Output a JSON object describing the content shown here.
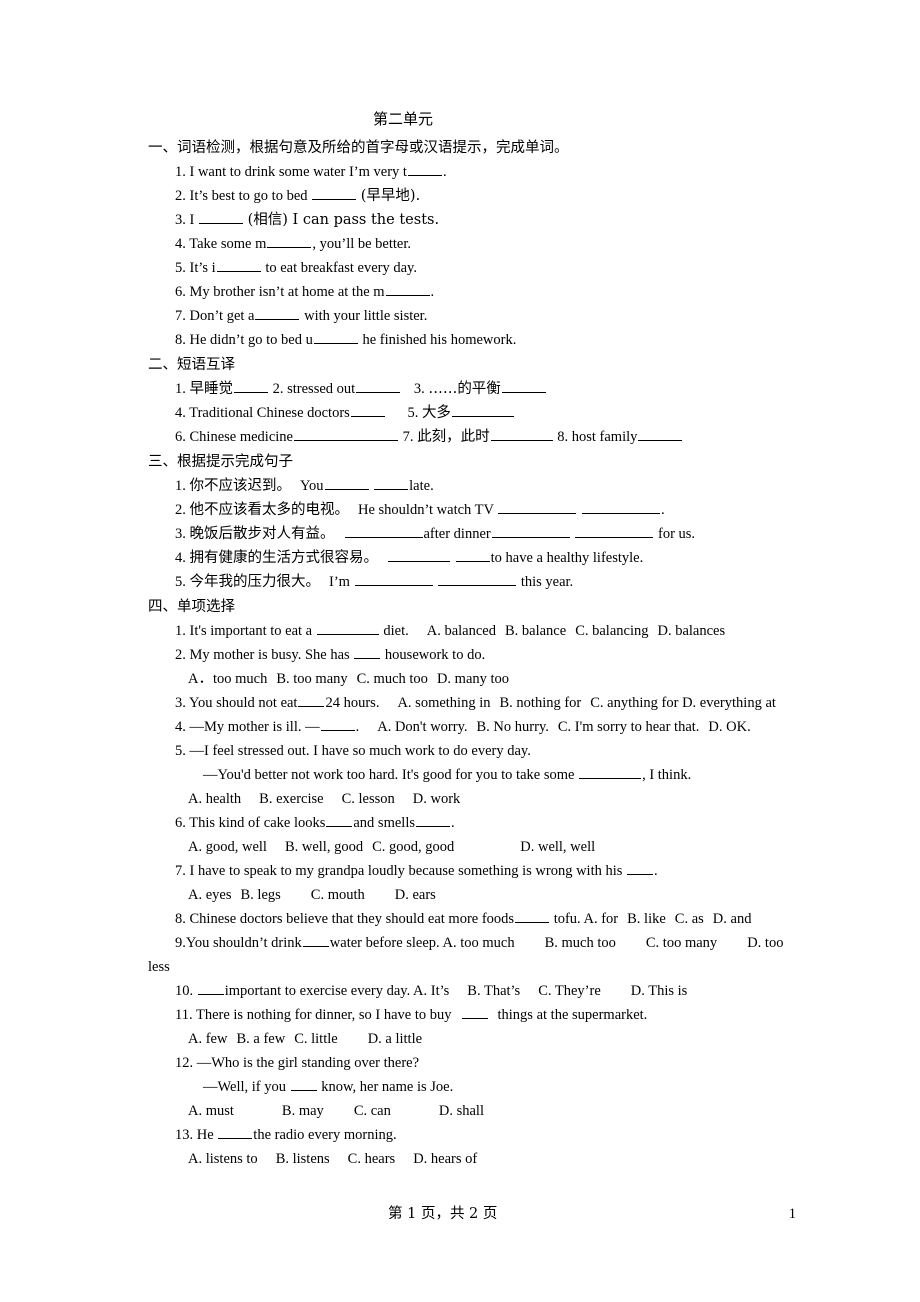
{
  "document": {
    "title": "第二单元",
    "footer": {
      "text": "第 1 页，共 2 页",
      "page_number": "1"
    }
  },
  "section1": {
    "heading": "一、词语检测，根据句意及所给的首字母或汉语提示，完成单词。",
    "items": [
      {
        "num": "1.",
        "pre": "I want to drink some water I’m very t",
        "post": "."
      },
      {
        "num": "2.",
        "pre": "It’s best to go to bed",
        "post": "(早早地)."
      },
      {
        "num": "3.",
        "pre": "I",
        "post": "(相信) I can pass the tests."
      },
      {
        "num": "4.",
        "pre": "Take some m",
        "post": ", you’ll be better."
      },
      {
        "num": "5.",
        "pre": "It’s i",
        "post": "to eat breakfast every day."
      },
      {
        "num": "6.",
        "pre": "My brother isn’t at home at the m",
        "post": "."
      },
      {
        "num": "7.",
        "pre": "Don’t get a",
        "post": "with your little sister."
      },
      {
        "num": "8.",
        "pre": "He didn’t go to bed u",
        "post": "he finished his homework."
      }
    ]
  },
  "section2": {
    "heading": "二、短语互译",
    "line1": {
      "a_num": "1.",
      "a_text": "早睡觉",
      "b_num": "2.",
      "b_text": "stressed out",
      "c_num": "3.",
      "c_text": "……的平衡"
    },
    "line2": {
      "a_num": "4.",
      "a_text": "Traditional Chinese doctors",
      "b_num": "5.",
      "b_text": "大多"
    },
    "line3": {
      "a_num": "6.",
      "a_text": "Chinese medicine",
      "b_num": "7.",
      "b_text": "此刻，此时",
      "c_num": "8.",
      "c_text": "host family"
    }
  },
  "section3": {
    "heading": "三、根据提示完成句子",
    "items": [
      {
        "num": "1.",
        "cn": "你不应该迟到。",
        "a": "You",
        "b": "late."
      },
      {
        "num": "2.",
        "cn": "他不应该看太多的电视。",
        "a": "He shouldn’t watch TV",
        "b": "."
      },
      {
        "num": "3.",
        "cn": "晚饭后散步对人有益。",
        "a": "",
        "b": "after dinner",
        "c": "for us."
      },
      {
        "num": "4.",
        "cn": "拥有健康的生活方式很容易。",
        "a": "",
        "b": "to have a healthy lifestyle."
      },
      {
        "num": "5.",
        "cn": "今年我的压力很大。",
        "a": "I’m",
        "b": "this year."
      }
    ]
  },
  "section4": {
    "heading": "四、单项选择",
    "q1": {
      "num": "1.",
      "pre": "It's important to eat a",
      "post": "diet.",
      "options": [
        "A. balanced",
        "B. balance",
        "C. balancing",
        "D. balances"
      ]
    },
    "q2": {
      "num": "2.",
      "pre": "My mother is busy. She has",
      "post": "housework to do.",
      "options": [
        "A．too much",
        "B. too many",
        "C. much too",
        "D. many too"
      ]
    },
    "q3": {
      "num": "3.",
      "pre": "You should not eat",
      "post": "24 hours.",
      "options": [
        "A. something in",
        "B. nothing for",
        "C. anything for D. everything at"
      ]
    },
    "q4": {
      "num": "4.",
      "pre": "—My mother is ill.  —",
      "post": ".",
      "options": [
        "A. Don't worry.",
        "B. No hurry.",
        "C. I'm sorry to hear that.",
        "D. OK."
      ]
    },
    "q5": {
      "num": "5.",
      "line1": "—I feel stressed out. I have so much work to do every day.",
      "line2_pre": "—You'd better not work too hard. It's good for you to take some",
      "line2_post": ", I think.",
      "options": [
        "A. health",
        "B. exercise",
        "C. lesson",
        "D. work"
      ]
    },
    "q6": {
      "num": "6.",
      "pre": "This kind of cake looks",
      "mid": "and smells",
      "post": ".",
      "options": [
        "A. good, well",
        "B. well, good",
        "C. good, good",
        "D. well, well"
      ]
    },
    "q7": {
      "num": "7.",
      "pre": "I have to speak to my grandpa loudly because something is wrong with his",
      "post": ".",
      "options": [
        "A. eyes",
        "B. legs",
        "C. mouth",
        "D. ears"
      ]
    },
    "q8": {
      "num": "8.",
      "pre": "Chinese doctors believe that they should eat more foods",
      "post": "tofu. A. for",
      "options": [
        "B. like",
        "C. as",
        "D. and"
      ]
    },
    "q9": {
      "num": "9.",
      "pre": "You shouldn’t drink",
      "post": "water before sleep. A. too much",
      "options": [
        "B. much too",
        "C. too many",
        "D. too"
      ],
      "overflow": "less"
    },
    "q10": {
      "num": "10.",
      "pre": "",
      "post": "important to exercise every day. A. It’s",
      "options": [
        "B. That’s",
        "C. They’re",
        "D. This is"
      ]
    },
    "q11": {
      "num": "11.",
      "pre": "There is nothing for dinner, so I have to buy",
      "post": "things at the supermarket.",
      "options": [
        "A. few",
        "B. a few",
        "C. little",
        "D. a little"
      ]
    },
    "q12": {
      "num": "12.",
      "line1": "—Who is the girl standing over there?",
      "line2_pre": "—Well, if you",
      "line2_post": "know, her name is Joe.",
      "options": [
        "A. must",
        "B. may",
        "C. can",
        "D. shall"
      ]
    },
    "q13": {
      "num": "13.",
      "pre": "He",
      "post": "the radio every morning.",
      "options": [
        "A. listens to",
        "B. listens",
        "C. hears",
        "D. hears of"
      ]
    }
  }
}
